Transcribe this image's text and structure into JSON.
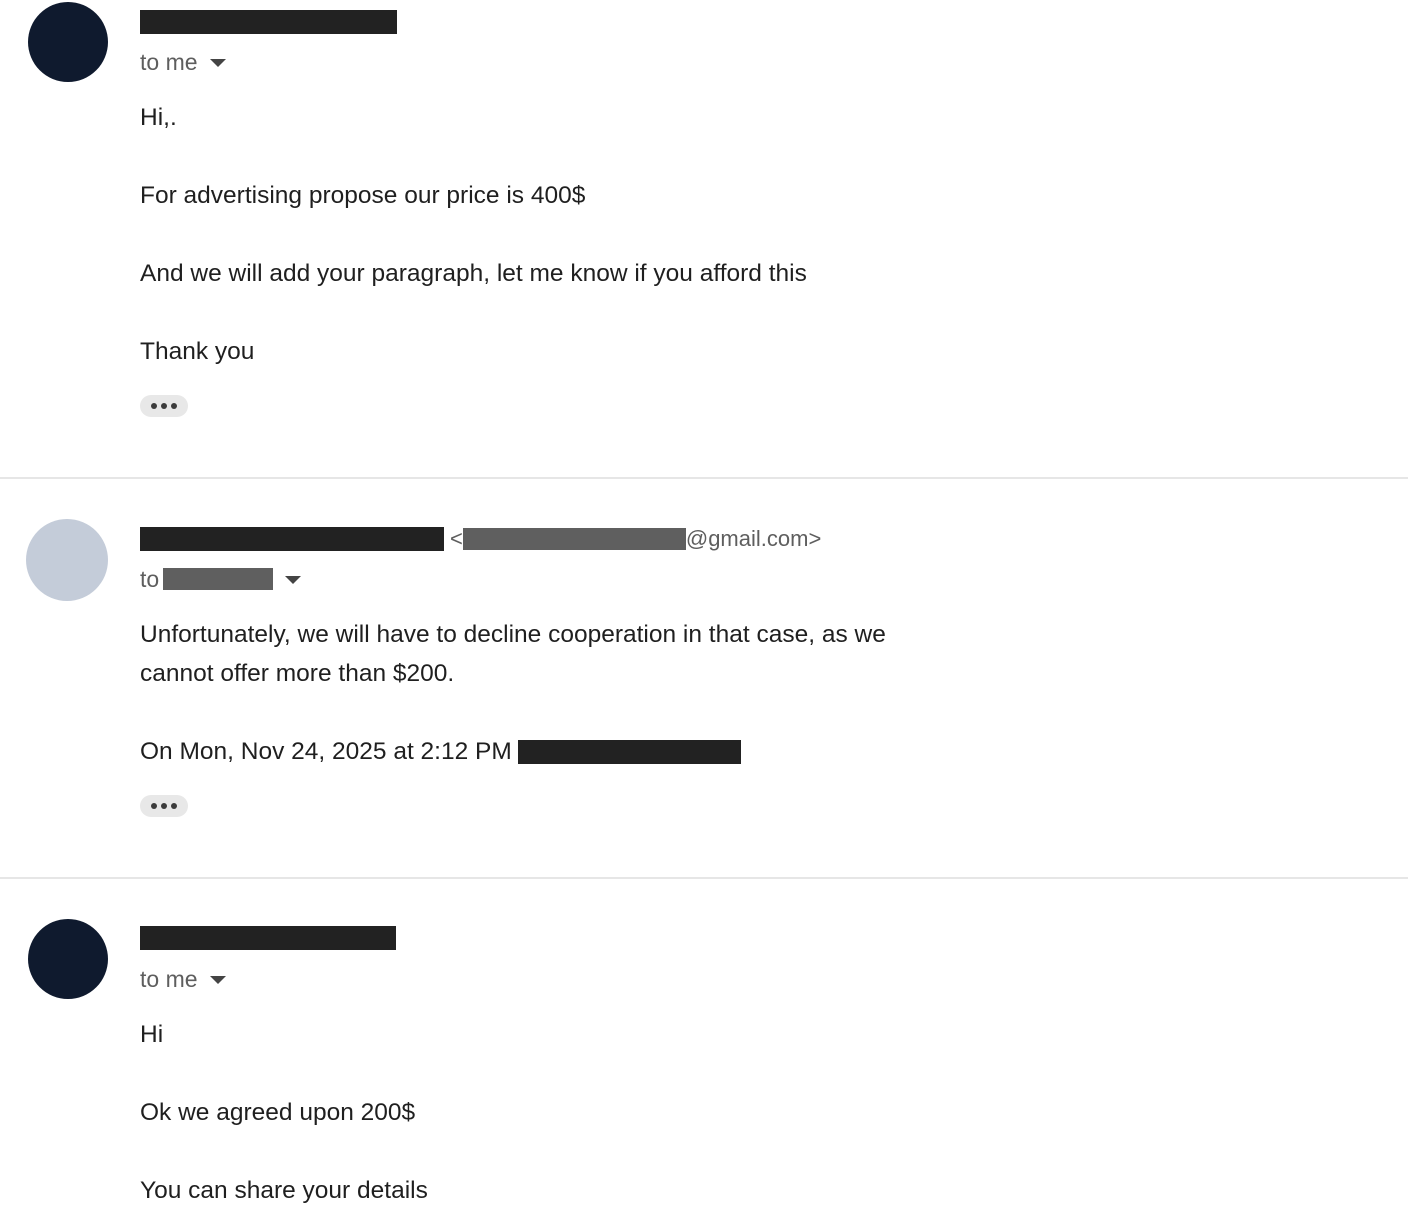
{
  "messages": [
    {
      "recipient_prefix": "to me",
      "body": [
        "Hi,.",
        "For advertising propose our price is 400$",
        "And we will add your paragraph, let me know if you afford this",
        "Thank you"
      ]
    },
    {
      "email_open": "<",
      "email_domain": "@gmail.com>",
      "recipient_prefix": "to",
      "body": [
        "Unfortunately, we will have to decline cooperation in that case, as we",
        "cannot offer more than $200.",
        "On Mon, Nov 24, 2025 at 2:12 PM"
      ]
    },
    {
      "recipient_prefix": "to me",
      "body": [
        "Hi",
        "Ok we agreed upon 200$",
        "You can share your details"
      ]
    }
  ],
  "icons": {
    "recipient_toggle": "chevron-down-icon",
    "show_trimmed": "more-horizontal-icon"
  },
  "colors": {
    "avatar_dark": "#0f1a2e",
    "avatar_light": "#c4ccd9",
    "redaction": "#222222"
  }
}
